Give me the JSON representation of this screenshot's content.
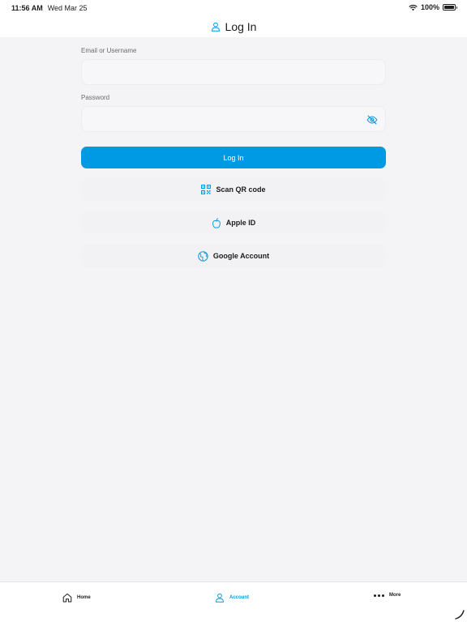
{
  "status_bar": {
    "time": "11:56 AM",
    "date": "Wed Mar 25",
    "battery": "100%",
    "icons": [
      "wifi-icon",
      "battery-icon"
    ]
  },
  "header": {
    "title": "Log In",
    "icon": "person-icon"
  },
  "form": {
    "email": {
      "label": "Email or Username",
      "value": "",
      "placeholder": ""
    },
    "password": {
      "label": "Password",
      "value": "",
      "placeholder": "",
      "toggle_icon": "eye-slash-icon"
    },
    "login_button": "Log In"
  },
  "alt_logins": [
    {
      "label": "Scan QR code",
      "icon": "qr-code-icon"
    },
    {
      "label": "Apple ID",
      "icon": "apple-icon"
    },
    {
      "label": "Google Account",
      "icon": "globe-icon"
    }
  ],
  "tab_bar": {
    "selected": "Account",
    "items": [
      {
        "label": "Home",
        "icon": "home-icon"
      },
      {
        "label": "Account",
        "icon": "person-icon"
      },
      {
        "label": "More",
        "icon": "more-dots-icon"
      }
    ]
  },
  "colors": {
    "accent": "#009ae4",
    "background": "#f4f4f6",
    "field_bg": "#f7f7f9",
    "text": "#1c1c1e"
  }
}
